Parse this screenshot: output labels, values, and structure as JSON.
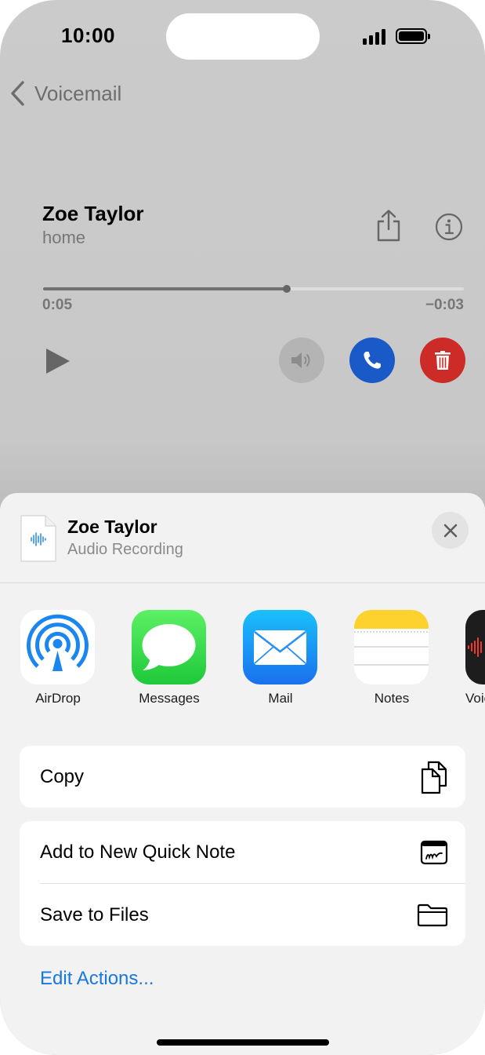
{
  "status_bar": {
    "time": "10:00"
  },
  "nav": {
    "back_label": "Voicemail"
  },
  "voicemail": {
    "name": "Zoe Taylor",
    "label": "home",
    "elapsed": "0:05",
    "remaining": "−0:03",
    "progress": 0.58
  },
  "share_sheet": {
    "title": "Zoe Taylor",
    "subtitle": "Audio Recording",
    "apps": [
      {
        "label": "AirDrop",
        "icon": "airdrop-icon"
      },
      {
        "label": "Messages",
        "icon": "messages-icon"
      },
      {
        "label": "Mail",
        "icon": "mail-icon"
      },
      {
        "label": "Notes",
        "icon": "notes-icon"
      },
      {
        "label": "Voic",
        "icon": "voice-memos-icon"
      }
    ],
    "actions": {
      "copy": "Copy",
      "quick_note": "Add to New Quick Note",
      "save_files": "Save to Files"
    },
    "edit_actions": "Edit Actions..."
  },
  "colors": {
    "call": "#1a5ac8",
    "delete": "#cd2b27",
    "link": "#1877e0"
  }
}
